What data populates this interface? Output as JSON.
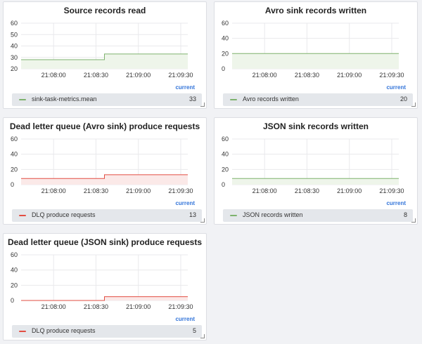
{
  "panels": [
    {
      "title": "Source records read",
      "legend_label": "sink-task-metrics.mean",
      "legend_value": "33",
      "current_label": "current",
      "color": "#7eb26d",
      "fill": "#eef5ea",
      "chart_data": {
        "type": "line",
        "yticks": [
          "60",
          "50",
          "40",
          "30",
          "20"
        ],
        "ylim": [
          20,
          60
        ],
        "xticks": [
          "21:08:00",
          "21:08:30",
          "21:09:00",
          "21:09:30"
        ],
        "series": [
          {
            "name": "sink-task-metrics.mean",
            "values": [
              {
                "x": "21:07:37",
                "y": 28
              },
              {
                "x": "21:08:36",
                "y": 28
              },
              {
                "x": "21:08:36",
                "y": 33
              },
              {
                "x": "21:09:35",
                "y": 33
              }
            ]
          }
        ]
      }
    },
    {
      "title": "Avro sink records written",
      "legend_label": "Avro records written",
      "legend_value": "20",
      "current_label": "current",
      "color": "#7eb26d",
      "fill": "#eef5ea",
      "chart_data": {
        "type": "line",
        "yticks": [
          "60",
          "40",
          "20",
          "0"
        ],
        "ylim": [
          0,
          60
        ],
        "xticks": [
          "21:08:00",
          "21:08:30",
          "21:09:00",
          "21:09:30"
        ],
        "series": [
          {
            "name": "Avro records written",
            "values": [
              {
                "x": "21:07:37",
                "y": 20
              },
              {
                "x": "21:09:35",
                "y": 20
              }
            ]
          }
        ]
      }
    },
    {
      "title": "Dead letter queue (Avro sink) produce requests",
      "legend_label": "DLQ produce requests",
      "legend_value": "13",
      "current_label": "current",
      "color": "#e24d42",
      "fill": "#fbe9e8",
      "chart_data": {
        "type": "line",
        "yticks": [
          "60",
          "40",
          "20",
          "0"
        ],
        "ylim": [
          0,
          60
        ],
        "xticks": [
          "21:08:00",
          "21:08:30",
          "21:09:00",
          "21:09:30"
        ],
        "series": [
          {
            "name": "DLQ produce requests",
            "values": [
              {
                "x": "21:07:37",
                "y": 8
              },
              {
                "x": "21:08:36",
                "y": 8
              },
              {
                "x": "21:08:36",
                "y": 13
              },
              {
                "x": "21:09:35",
                "y": 13
              }
            ]
          }
        ]
      }
    },
    {
      "title": "JSON sink records written",
      "legend_label": "JSON records written",
      "legend_value": "8",
      "current_label": "current",
      "color": "#7eb26d",
      "fill": "#eef5ea",
      "chart_data": {
        "type": "line",
        "yticks": [
          "60",
          "40",
          "20",
          "0"
        ],
        "ylim": [
          0,
          60
        ],
        "xticks": [
          "21:08:00",
          "21:08:30",
          "21:09:00",
          "21:09:30"
        ],
        "series": [
          {
            "name": "JSON records written",
            "values": [
              {
                "x": "21:07:37",
                "y": 8
              },
              {
                "x": "21:09:35",
                "y": 8
              }
            ]
          }
        ]
      }
    },
    {
      "title": "Dead letter queue (JSON sink) produce requests",
      "legend_label": "DLQ produce requests",
      "legend_value": "5",
      "current_label": "current",
      "color": "#e24d42",
      "fill": "#fbe9e8",
      "chart_data": {
        "type": "line",
        "yticks": [
          "60",
          "40",
          "20",
          "0"
        ],
        "ylim": [
          0,
          60
        ],
        "xticks": [
          "21:08:00",
          "21:08:30",
          "21:09:00",
          "21:09:30"
        ],
        "series": [
          {
            "name": "DLQ produce requests",
            "values": [
              {
                "x": "21:07:37",
                "y": 0
              },
              {
                "x": "21:08:36",
                "y": 0
              },
              {
                "x": "21:08:36",
                "y": 5
              },
              {
                "x": "21:09:35",
                "y": 5
              }
            ]
          }
        ]
      }
    }
  ]
}
